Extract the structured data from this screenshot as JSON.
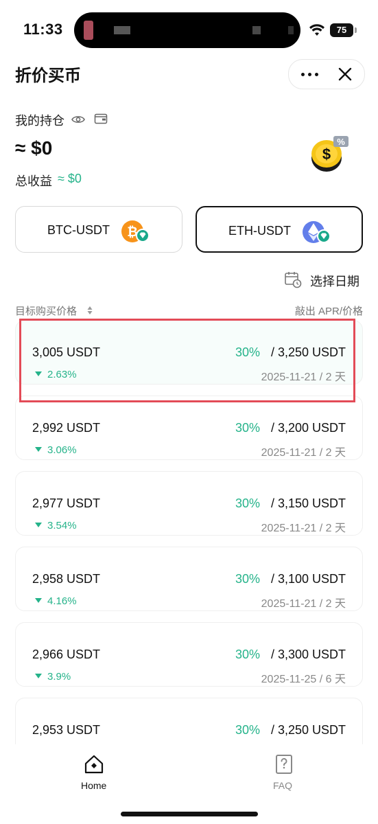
{
  "status_bar": {
    "time": "11:33",
    "battery": "75"
  },
  "header": {
    "title": "折价买币"
  },
  "holdings": {
    "label": "我的持仓",
    "value": "≈ $0",
    "profit_label": "总收益",
    "profit_value": "≈ $0"
  },
  "pairs": [
    {
      "label": "BTC-USDT",
      "active": false
    },
    {
      "label": "ETH-USDT",
      "active": true
    }
  ],
  "date_select": {
    "label": "选择日期"
  },
  "columns": {
    "left": "目标购买价格",
    "right": "敲出 APR/价格"
  },
  "rows": [
    {
      "price": "3,005 USDT",
      "change": "2.63%",
      "apr": "30%",
      "sell": "/ 3,250 USDT",
      "date": "2025-11-21 / 2 天"
    },
    {
      "price": "2,992 USDT",
      "change": "3.06%",
      "apr": "30%",
      "sell": "/ 3,200 USDT",
      "date": "2025-11-21 / 2 天"
    },
    {
      "price": "2,977 USDT",
      "change": "3.54%",
      "apr": "30%",
      "sell": "/ 3,150 USDT",
      "date": "2025-11-21 / 2 天"
    },
    {
      "price": "2,958 USDT",
      "change": "4.16%",
      "apr": "30%",
      "sell": "/ 3,100 USDT",
      "date": "2025-11-21 / 2 天"
    },
    {
      "price": "2,966 USDT",
      "change": "3.9%",
      "apr": "30%",
      "sell": "/ 3,300 USDT",
      "date": "2025-11-25 / 6 天"
    },
    {
      "price": "2,953 USDT",
      "change": "",
      "apr": "30%",
      "sell": "/ 3,250 USDT",
      "date": ""
    }
  ],
  "bottom_nav": {
    "home": "Home",
    "faq": "FAQ"
  },
  "colors": {
    "accent_green": "#25b38a",
    "highlight_red": "#e34b57",
    "btc_orange": "#f7931a",
    "eth_purple": "#627eea"
  }
}
